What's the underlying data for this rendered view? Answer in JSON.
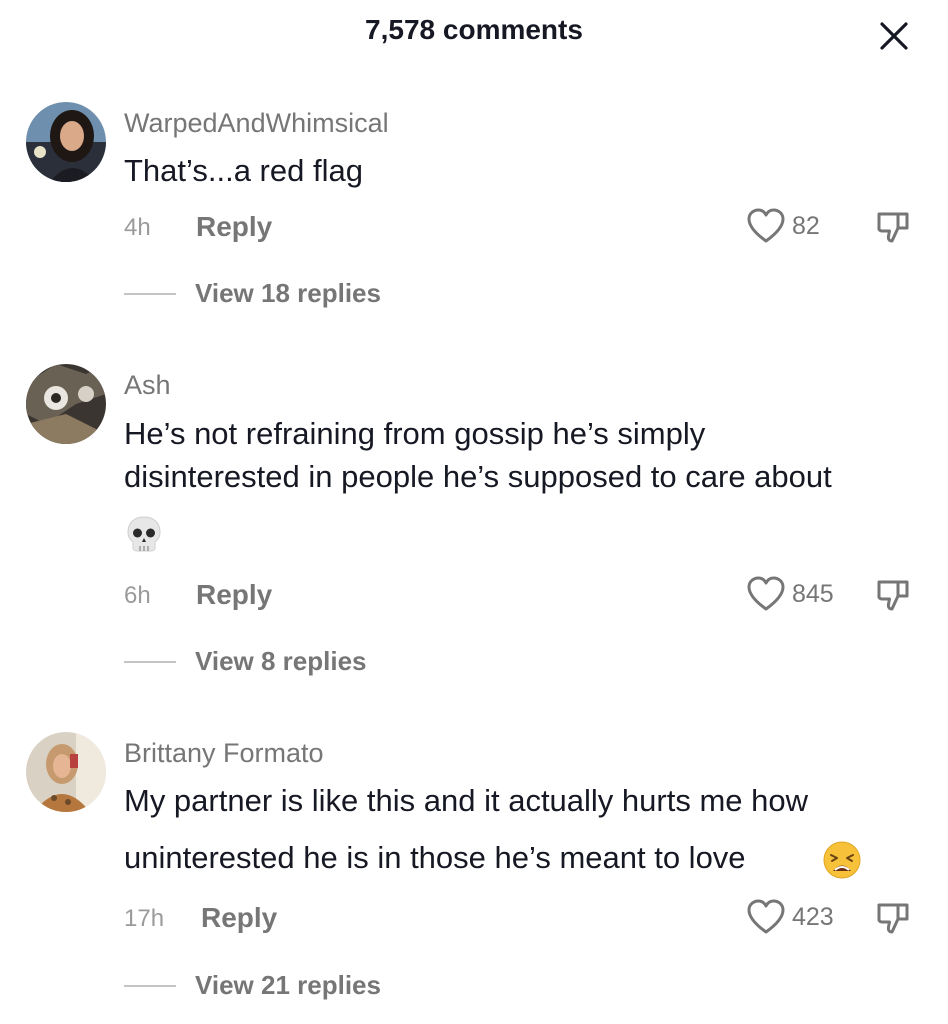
{
  "header": {
    "title": "7,578 comments",
    "close_icon": "close-icon"
  },
  "colors": {
    "text": "#161823",
    "secondary": "#767676",
    "muted": "#9a9a9a",
    "background": "#ffffff"
  },
  "comments": [
    {
      "username": "WarpedAndWhimsical",
      "text_lines": [
        "That’s...a red flag"
      ],
      "time": "4h",
      "reply_label": "Reply",
      "likes": "82",
      "view_replies": "View 18 replies"
    },
    {
      "username": "Ash",
      "text_lines": [
        "He’s not refraining from gossip he’s simply",
        "disinterested in people he’s supposed to care about"
      ],
      "emoji": "skull-emoji",
      "time": "6h",
      "reply_label": "Reply",
      "likes": "845",
      "view_replies": "View 8 replies"
    },
    {
      "username": "Brittany Formato",
      "text_lines": [
        "My partner is like this and it actually hurts me how",
        "uninterested he is in those he’s meant to love"
      ],
      "emoji": "weary-face-emoji",
      "time": "17h",
      "reply_label": "Reply",
      "likes": "423",
      "view_replies": "View 21 replies"
    }
  ]
}
